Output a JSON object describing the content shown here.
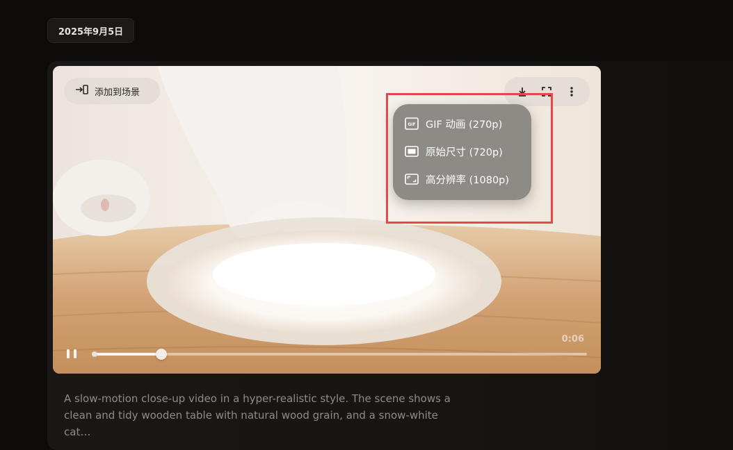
{
  "header": {
    "date": "2025年9月5日"
  },
  "video": {
    "add_to_scene_label": "添加到场景",
    "toolbar": {
      "icons": [
        "download-icon",
        "fullscreen-icon",
        "more-vert-icon"
      ]
    },
    "download_menu": {
      "items": [
        {
          "label": "GIF 动画 (270p)",
          "icon": "gif-icon"
        },
        {
          "label": "原始尺寸 (720p)",
          "icon": "original-size-icon"
        },
        {
          "label": "高分辨率 (1080p)",
          "icon": "high-res-icon"
        }
      ]
    },
    "player": {
      "time": "0:06",
      "progress": 0.14
    }
  },
  "description": "A slow-motion close-up video in a hyper-realistic style. The scene shows a\nclean and tidy wooden table with natural wood grain, and a snow-white cat…",
  "colors": {
    "highlight_border": "#e5474a",
    "menu_background": "#8a8783",
    "page_background": "#0d0c0b"
  }
}
